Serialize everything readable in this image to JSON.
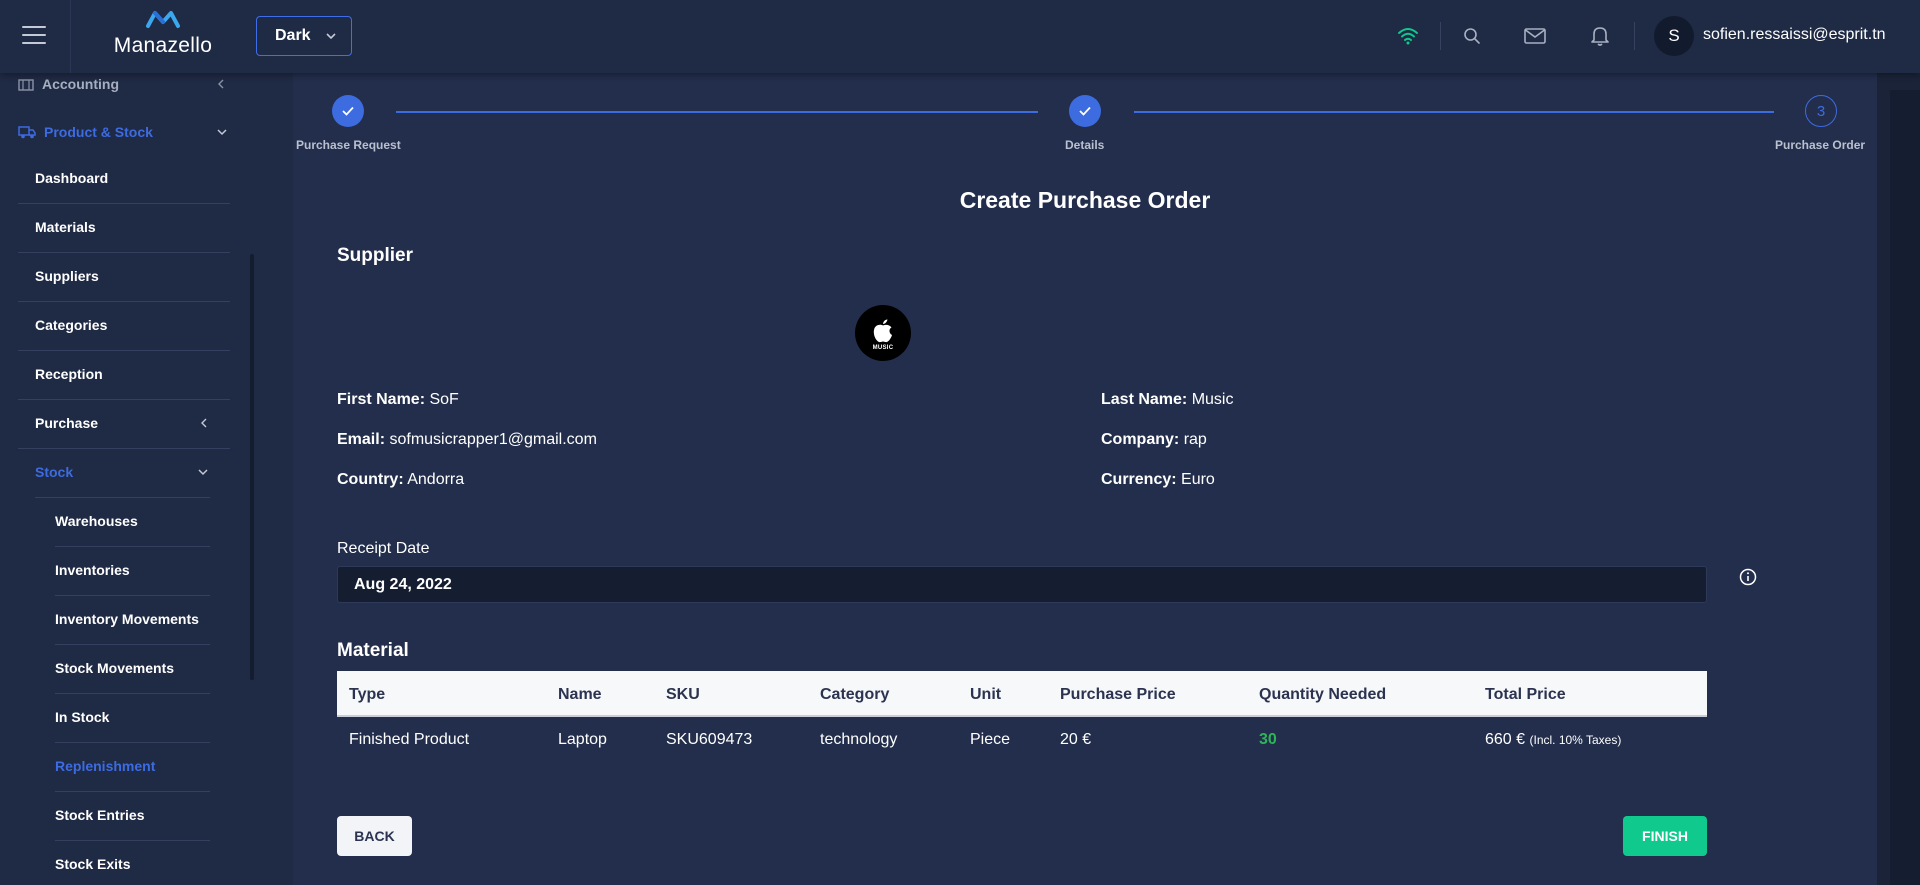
{
  "header": {
    "logo_text": "Manazello",
    "theme_value": "Dark",
    "avatar_initial": "S",
    "user_email": "sofien.ressaissi@esprit.tn"
  },
  "sidebar": {
    "accounting": "Accounting",
    "product_stock": "Product & Stock",
    "items": [
      "Dashboard",
      "Materials",
      "Suppliers",
      "Categories",
      "Reception",
      "Purchase",
      "Stock"
    ],
    "stock_items": [
      "Warehouses",
      "Inventories",
      "Inventory Movements",
      "Stock Movements",
      "In Stock",
      "Replenishment",
      "Stock Entries",
      "Stock Exits"
    ]
  },
  "stepper": {
    "steps": [
      "Purchase Request",
      "Details",
      "Purchase Order"
    ],
    "current_number": "3"
  },
  "page": {
    "title": "Create Purchase Order",
    "supplier_heading": "Supplier",
    "logo_caption": "MUSIC",
    "material_heading": "Material"
  },
  "supplier": {
    "first_name_label": "First Name:",
    "first_name": "SoF",
    "last_name_label": "Last Name:",
    "last_name": "Music",
    "email_label": "Email:",
    "email": "sofmusicrapper1@gmail.com",
    "company_label": "Company:",
    "company": "rap",
    "country_label": "Country:",
    "country": "Andorra",
    "currency_label": "Currency:",
    "currency": "Euro"
  },
  "receipt": {
    "label": "Receipt Date",
    "value": "Aug 24, 2022"
  },
  "table": {
    "headers": [
      "Type",
      "Name",
      "SKU",
      "Category",
      "Unit",
      "Purchase Price",
      "Quantity Needed",
      "Total Price"
    ],
    "rows": [
      {
        "type": "Finished Product",
        "name": "Laptop",
        "sku": "SKU609473",
        "category": "technology",
        "unit": "Piece",
        "purchase_price": "20 €",
        "quantity": "30",
        "total": "660 €",
        "total_note": "(Incl. 10% Taxes)"
      }
    ]
  },
  "buttons": {
    "back": "BACK",
    "finish": "FINISH"
  },
  "colors": {
    "accent": "#3d6be0",
    "finish": "#10c98d",
    "quantity": "#2fb35a",
    "wifi": "#10c98d"
  }
}
